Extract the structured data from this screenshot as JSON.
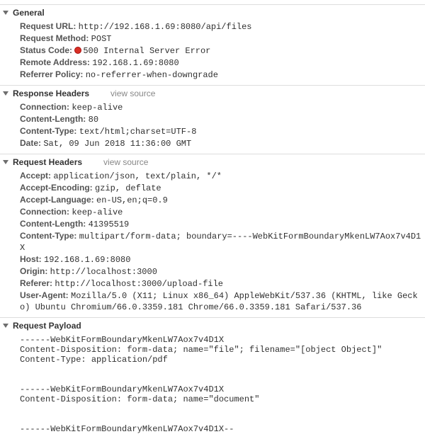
{
  "sections": {
    "general": {
      "title": "General",
      "entries": [
        {
          "label": "Request URL:",
          "value": "http://192.168.1.69:8080/api/files"
        },
        {
          "label": "Request Method:",
          "value": "POST"
        },
        {
          "label": "Status Code:",
          "value": "500 Internal Server Error",
          "status_dot": true
        },
        {
          "label": "Remote Address:",
          "value": "192.168.1.69:8080"
        },
        {
          "label": "Referrer Policy:",
          "value": "no-referrer-when-downgrade"
        }
      ]
    },
    "response_headers": {
      "title": "Response Headers",
      "view_source": "view source",
      "entries": [
        {
          "label": "Connection:",
          "value": "keep-alive"
        },
        {
          "label": "Content-Length:",
          "value": "80"
        },
        {
          "label": "Content-Type:",
          "value": "text/html;charset=UTF-8"
        },
        {
          "label": "Date:",
          "value": "Sat, 09 Jun 2018 11:36:00 GMT"
        }
      ]
    },
    "request_headers": {
      "title": "Request Headers",
      "view_source": "view source",
      "entries": [
        {
          "label": "Accept:",
          "value": "application/json, text/plain, */*"
        },
        {
          "label": "Accept-Encoding:",
          "value": "gzip, deflate"
        },
        {
          "label": "Accept-Language:",
          "value": "en-US,en;q=0.9"
        },
        {
          "label": "Connection:",
          "value": "keep-alive"
        },
        {
          "label": "Content-Length:",
          "value": "41395519"
        },
        {
          "label": "Content-Type:",
          "value": "multipart/form-data; boundary=----WebKitFormBoundaryMkenLW7Aox7v4D1X"
        },
        {
          "label": "Host:",
          "value": "192.168.1.69:8080"
        },
        {
          "label": "Origin:",
          "value": "http://localhost:3000"
        },
        {
          "label": "Referer:",
          "value": "http://localhost:3000/upload-file"
        },
        {
          "label": "User-Agent:",
          "value": "Mozilla/5.0 (X11; Linux x86_64) AppleWebKit/537.36 (KHTML, like Gecko) Ubuntu Chromium/66.0.3359.181 Chrome/66.0.3359.181 Safari/537.36"
        }
      ]
    },
    "request_payload": {
      "title": "Request Payload",
      "body": "------WebKitFormBoundaryMkenLW7Aox7v4D1X\nContent-Disposition: form-data; name=\"file\"; filename=\"[object Object]\"\nContent-Type: application/pdf\n\n\n------WebKitFormBoundaryMkenLW7Aox7v4D1X\nContent-Disposition: form-data; name=\"document\"\n\n\n------WebKitFormBoundaryMkenLW7Aox7v4D1X--"
    }
  }
}
